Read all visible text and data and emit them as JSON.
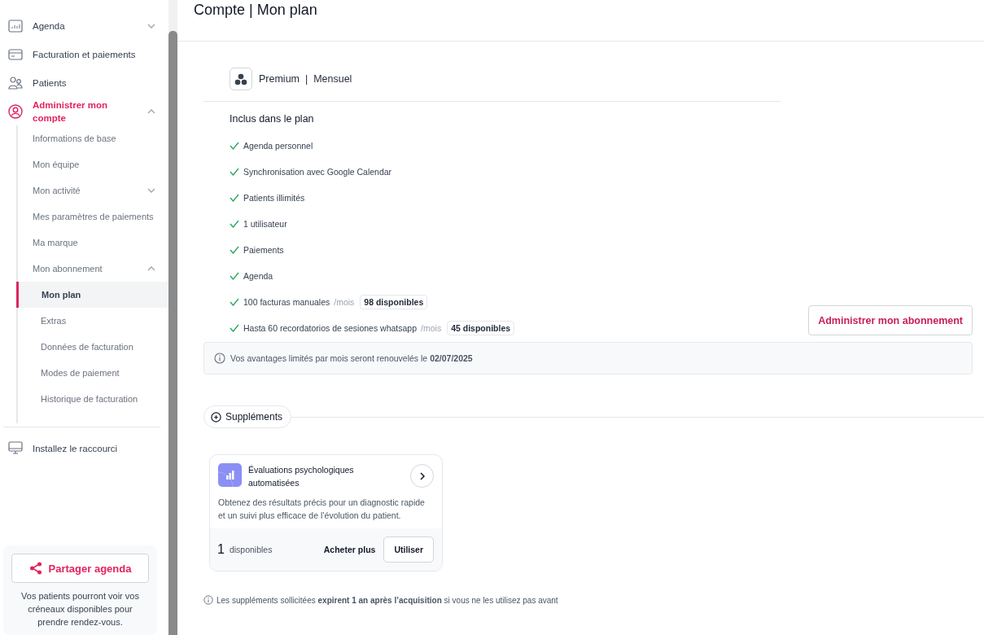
{
  "sidebar": {
    "nav": [
      {
        "label": "Agenda",
        "selected": false,
        "expanded": false
      },
      {
        "label": "Facturation et paiements",
        "selected": false
      },
      {
        "label": "Patients",
        "selected": false
      },
      {
        "label": "Administrer mon compte",
        "selected": true,
        "expanded": true,
        "children": [
          {
            "label": "Informations de base",
            "selected": false
          },
          {
            "label": "Mon équipe",
            "selected": false
          },
          {
            "label": "Mon activité",
            "selected": false,
            "expanded": false
          },
          {
            "label": "Mes paramètres de paiements",
            "selected": false
          },
          {
            "label": "Ma marque",
            "selected": false
          },
          {
            "label": "Mon abonnement",
            "selected": false,
            "expanded": true,
            "children": [
              {
                "label": "Mon plan",
                "selected": true
              },
              {
                "label": "Extras",
                "selected": false
              },
              {
                "label": "Données de facturation",
                "selected": false
              },
              {
                "label": "Modes de paiement",
                "selected": false
              },
              {
                "label": "Historique de facturation",
                "selected": false
              }
            ]
          }
        ]
      }
    ],
    "shortcut": "Installez le raccourci",
    "share": {
      "button": "Partager agenda",
      "text": "Vos patients pourront voir vos créneaux disponibles pour prendre rendez-vous."
    }
  },
  "page": {
    "title": "Compte | Mon plan",
    "plan": {
      "name": "Premium  |  Mensuel",
      "included_title": "Inclus dans le plan",
      "features": [
        {
          "text": "Agenda personnel"
        },
        {
          "text": "Synchronisation avec Google Calendar"
        },
        {
          "text": "Patients illimités"
        },
        {
          "text": "1 utilisateur"
        },
        {
          "text": "Paiements"
        },
        {
          "text": "Agenda"
        },
        {
          "text": "100 facturas manuales",
          "unit": "/mois",
          "badge": "98 disponibles"
        },
        {
          "text": "Hasta 60 recordatorios de sesiones whatsapp",
          "unit": "/mois",
          "badge": "45 disponibles"
        }
      ],
      "manage_button": "Administrer mon abonnement",
      "notice": "Vos avantages limités par mois seront renouvelés le **02/07/2025**"
    },
    "supplements": {
      "label": "Suppléments",
      "cards": [
        {
          "title": "Évaluations psychologiques automatisées",
          "description": "Obtenez des résultats précis pour un diagnostic rapide et un suivi plus efficace de l’évolution du patient.",
          "count": "1",
          "count_label": "disponibles",
          "buy": "Acheter plus",
          "use": "Utiliser"
        }
      ],
      "footnote": "Les suppléments sollicitées **expirent 1 an après l’acquisition** si vous ne les utilisez pas avant"
    }
  }
}
